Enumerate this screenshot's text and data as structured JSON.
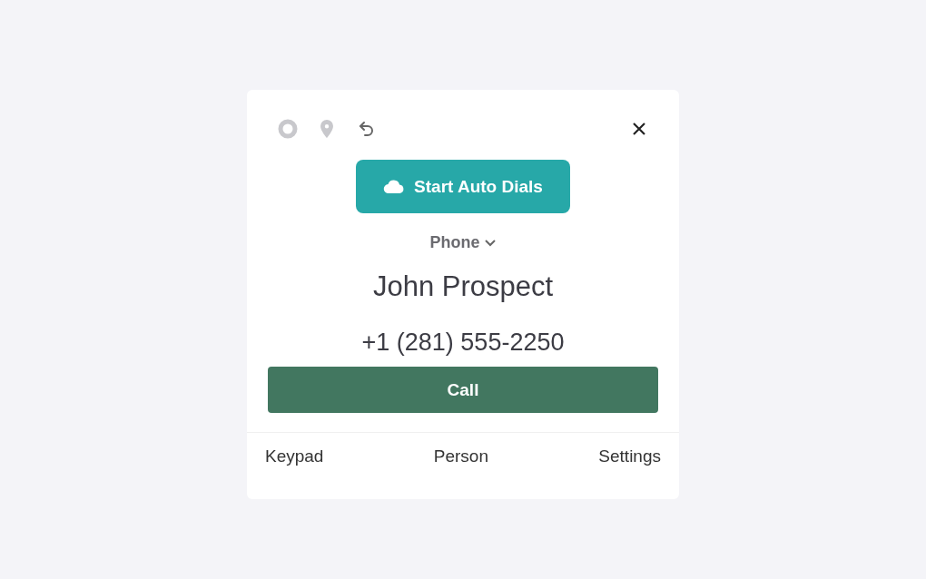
{
  "auto_dial_button": {
    "label": "Start Auto Dials"
  },
  "line_selector": {
    "label": "Phone"
  },
  "contact": {
    "name": "John Prospect",
    "phone": "+1 (281) 555-2250"
  },
  "call_button": {
    "label": "Call"
  },
  "bottom_nav": [
    {
      "label": "Keypad"
    },
    {
      "label": "Person"
    },
    {
      "label": "Settings"
    }
  ]
}
